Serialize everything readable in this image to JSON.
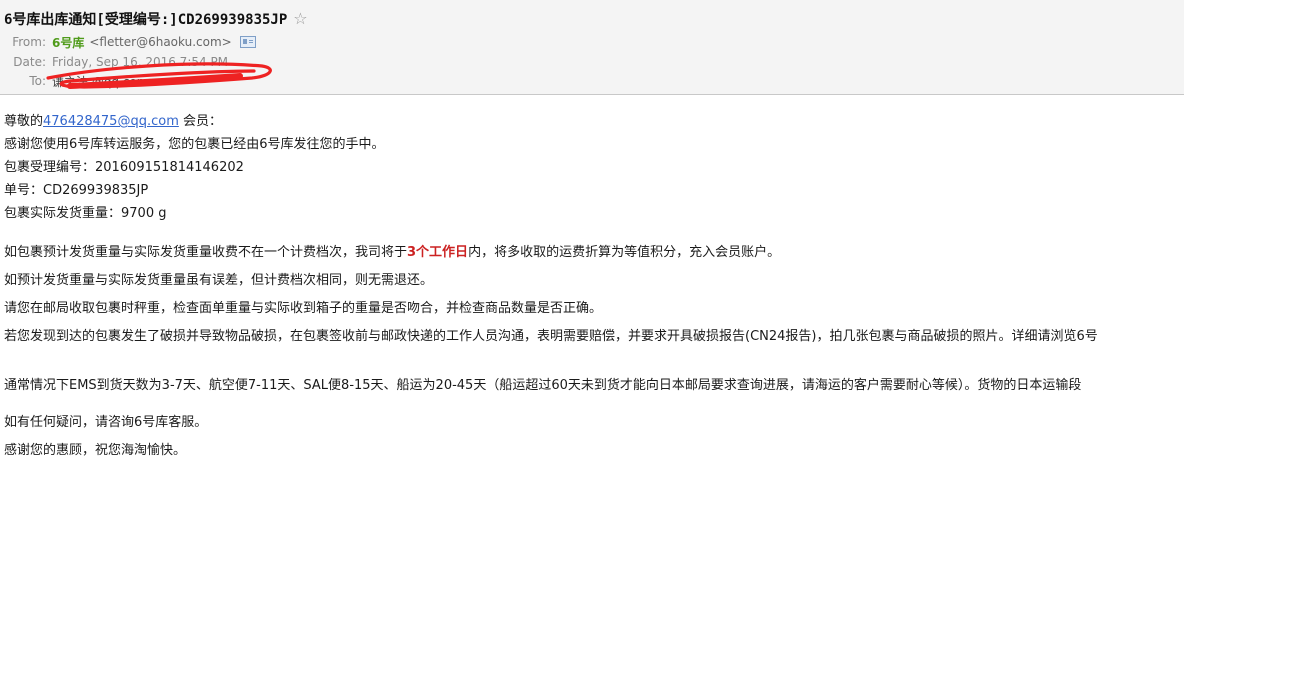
{
  "header": {
    "subject": "6号库出库通知[受理编号:]CD269939835JP",
    "star_icon": "star-icon",
    "from_label": "From:",
    "from_name": "6号库",
    "from_email": "<fletter@6haoku.com>",
    "vcard_icon": "address-card-icon",
    "date_label": "Date:",
    "date_value": "Friday, Sep 16, 2016 7:54 PM",
    "to_label": "To:",
    "to_value": "谦之法 @qq.com>"
  },
  "colors": {
    "accent": "#4f9b1a",
    "link": "#3366cc",
    "highlight": "#cc2222",
    "redaction": "#ee2222"
  },
  "body": {
    "greeting_prefix": "尊敬的",
    "greeting_link": "476428475@qq.com",
    "greeting_suffix": " 会员：",
    "thanks_line": "感谢您使用6号库转运服务，您的包裹已经由6号库发往您的手中。",
    "package_id_line": "包裹受理编号：201609151814146202",
    "tracking_line": "单号：CD269939835JP",
    "weight_line": "包裹实际发货重量：9700 g",
    "p1_prefix": "如包裹预计发货重量与实际发货重量收费不在一个计费档次，我司将于",
    "p1_highlight": "3个工作日",
    "p1_suffix": "内，将多收取的运费折算为等值积分，充入会员账户。",
    "p2": "如预计发货重量与实际发货重量虽有误差，但计费档次相同，则无需退还。",
    "p3": "请您在邮局收取包裹时秤重，检查面单重量与实际收到箱子的重量是否吻合，并检查商品数量是否正确。",
    "p4": "若您发现到达的包裹发生了破损并导致物品破损，在包裹签收前与邮政快递的工作人员沟通，表明需要赔偿，并要求开具破损报告(CN24报告)，拍几张包裹与商品破损的照片。详细请浏览6号",
    "p5": "通常情况下EMS到货天数为3-7天、航空便7-11天、SAL便8-15天、船运为20-45天（船运超过60天未到货才能向日本邮局要求查询进展，请海运的客户需要耐心等候）。货物的日本运输段",
    "p6": "如有任何疑问，请咨询6号库客服。",
    "p7": "感谢您的惠顾，祝您海淘愉快。"
  }
}
